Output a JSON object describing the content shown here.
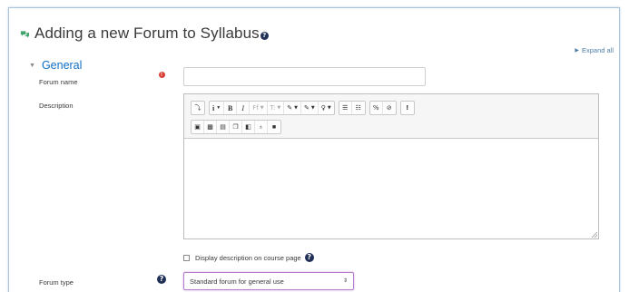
{
  "header": {
    "title": "Adding a new Forum to Syllabus",
    "help_glyph": "?",
    "expand_all": "Expand all",
    "forum_icon_color": "#3fa56b"
  },
  "section": {
    "title": "General",
    "accent": "#0f6fc5"
  },
  "fields": {
    "forum_name_label": "Forum name",
    "forum_name_value": "",
    "required_glyph": "!",
    "description_label": "Description",
    "display_description_label": "Display description on course page",
    "forum_type_label": "Forum type",
    "forum_type_value": "Standard forum for general use"
  },
  "toolbar": {
    "row1": [
      {
        "icon": "toggle-toolbar-icon",
        "glyph": "⤵"
      },
      {
        "icon": "info-dropdown-icon",
        "glyph": "i"
      },
      {
        "icon": "bold-icon",
        "glyph": "B"
      },
      {
        "icon": "italic-icon",
        "glyph": "I"
      },
      {
        "icon": "font-family-icon",
        "glyph": "Ff"
      },
      {
        "icon": "font-size-icon",
        "glyph": "T:"
      },
      {
        "icon": "text-color-icon",
        "glyph": "✎"
      },
      {
        "icon": "background-color-icon",
        "glyph": "✎"
      },
      {
        "icon": "style-icon",
        "glyph": "♀"
      },
      {
        "icon": "unordered-list-icon",
        "glyph": "☰"
      },
      {
        "icon": "ordered-list-icon",
        "glyph": "☷"
      },
      {
        "icon": "link-icon",
        "glyph": "%"
      },
      {
        "icon": "unlink-icon",
        "glyph": "⊘"
      },
      {
        "icon": "emphasis-icon",
        "glyph": "!"
      }
    ],
    "row2": [
      {
        "icon": "media-icon",
        "glyph": "▣"
      },
      {
        "icon": "image-icon",
        "glyph": "▩"
      },
      {
        "icon": "file-icon",
        "glyph": "▤"
      },
      {
        "icon": "copy-icon",
        "glyph": "❐"
      },
      {
        "icon": "paste-icon",
        "glyph": "◧"
      },
      {
        "icon": "microphone-icon",
        "glyph": "♁"
      },
      {
        "icon": "video-camera-icon",
        "glyph": "■"
      }
    ]
  }
}
